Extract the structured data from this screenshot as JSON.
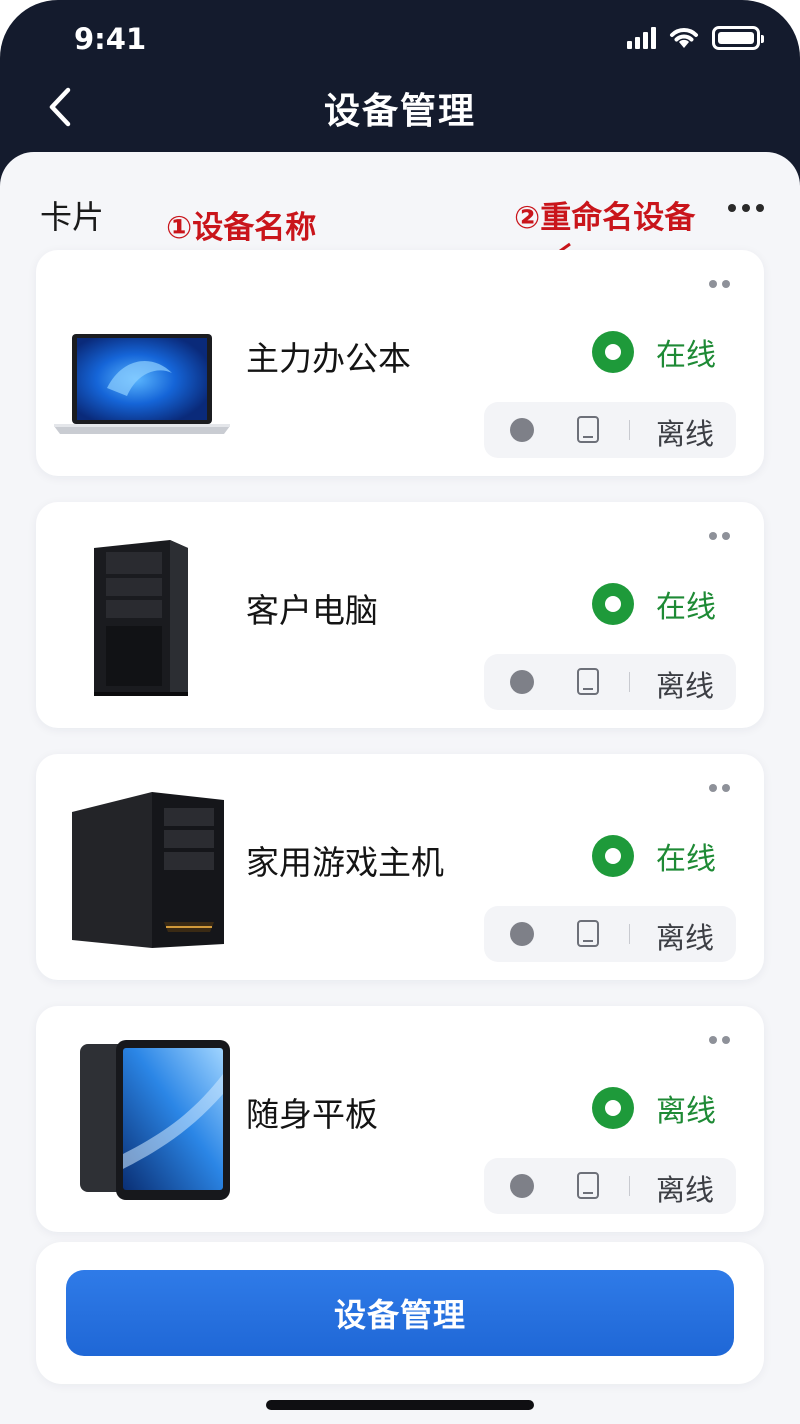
{
  "status_bar": {
    "time": "9:41"
  },
  "nav": {
    "title": "设备管理"
  },
  "section": {
    "label": "卡片"
  },
  "annotations": {
    "first": "①设备名称",
    "second": "②重命名设备"
  },
  "devices": [
    {
      "name": "主力办公本",
      "status": "在线",
      "pill_status": "离线",
      "image": "laptop-image"
    },
    {
      "name": "客户电脑",
      "status": "在线",
      "pill_status": "离线",
      "image": "desktop-tower-image"
    },
    {
      "name": "家用游戏主机",
      "status": "在线",
      "pill_status": "离线",
      "image": "gaming-pc-image"
    },
    {
      "name": "随身平板",
      "status": "离线",
      "pill_status": "离线",
      "image": "tablet-image"
    }
  ],
  "footer": {
    "button_label": "设备管理"
  },
  "colors": {
    "online_green": "#1e9a3a",
    "primary_blue": "#1f67d6",
    "annotation_red": "#c9151b",
    "header_dark": "#141b2d"
  }
}
